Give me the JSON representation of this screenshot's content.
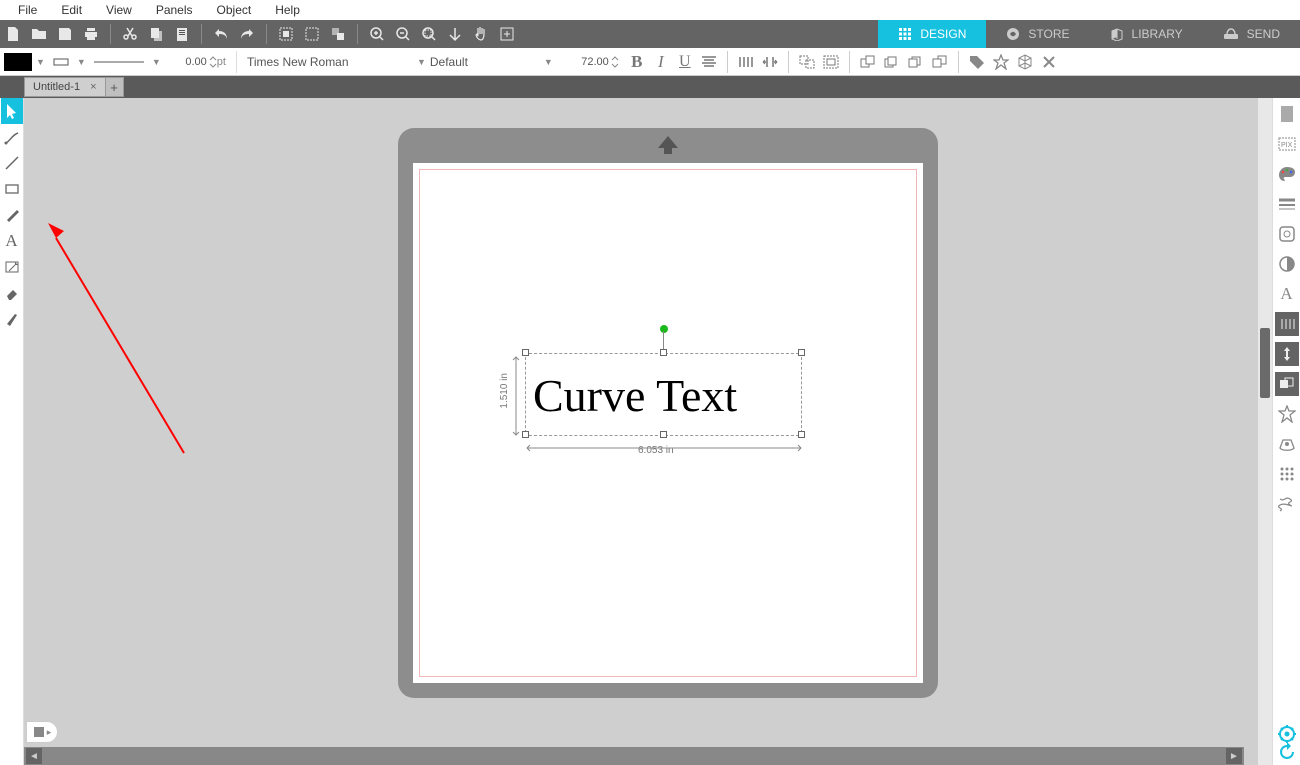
{
  "menu": {
    "items": [
      "File",
      "Edit",
      "View",
      "Panels",
      "Object",
      "Help"
    ]
  },
  "nav": {
    "design": "DESIGN",
    "store": "STORE",
    "library": "LIBRARY",
    "send": "SEND"
  },
  "format": {
    "stroke_weight": "0.00",
    "unit": "pt",
    "font": "Times New Roman",
    "style": "Default",
    "size": "72.00"
  },
  "tabs": {
    "doc": "Untitled-1",
    "close": "×",
    "new": "+"
  },
  "canvas": {
    "text": "Curve Text",
    "width_label": "6.053 in",
    "height_label": "1.510 in"
  }
}
